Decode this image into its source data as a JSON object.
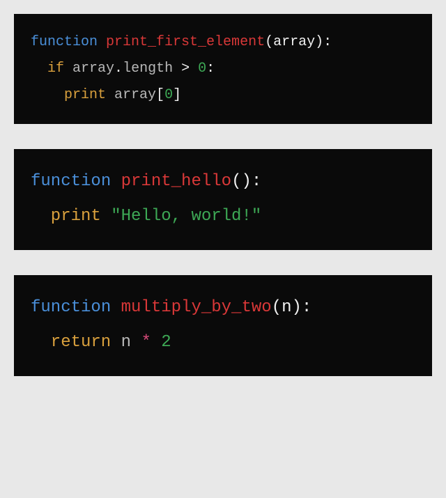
{
  "blocks": [
    {
      "lines": [
        {
          "indent": 0,
          "tokens": [
            {
              "cls": "kw",
              "t": "function"
            },
            {
              "cls": "",
              "t": " "
            },
            {
              "cls": "fn",
              "t": "print_first_element"
            },
            {
              "cls": "paren",
              "t": "("
            },
            {
              "cls": "param",
              "t": "array"
            },
            {
              "cls": "paren",
              "t": ")"
            },
            {
              "cls": "colon",
              "t": ":"
            }
          ]
        },
        {
          "indent": 1,
          "tokens": [
            {
              "cls": "ctrl",
              "t": "if"
            },
            {
              "cls": "",
              "t": " "
            },
            {
              "cls": "ident",
              "t": "array"
            },
            {
              "cls": "dot",
              "t": "."
            },
            {
              "cls": "ident",
              "t": "length"
            },
            {
              "cls": "",
              "t": " "
            },
            {
              "cls": "op",
              "t": ">"
            },
            {
              "cls": "",
              "t": " "
            },
            {
              "cls": "num",
              "t": "0"
            },
            {
              "cls": "colon",
              "t": ":"
            }
          ]
        },
        {
          "indent": 2,
          "tokens": [
            {
              "cls": "ctrl",
              "t": "print"
            },
            {
              "cls": "",
              "t": " "
            },
            {
              "cls": "ident",
              "t": "array"
            },
            {
              "cls": "paren",
              "t": "["
            },
            {
              "cls": "num",
              "t": "0"
            },
            {
              "cls": "paren",
              "t": "]"
            }
          ]
        }
      ]
    },
    {
      "lines": [
        {
          "indent": 0,
          "tokens": [
            {
              "cls": "kw",
              "t": "function"
            },
            {
              "cls": "",
              "t": " "
            },
            {
              "cls": "fn",
              "t": "print_hello"
            },
            {
              "cls": "paren",
              "t": "("
            },
            {
              "cls": "paren",
              "t": ")"
            },
            {
              "cls": "colon",
              "t": ":"
            }
          ]
        },
        {
          "indent": 1,
          "tokens": [
            {
              "cls": "ctrl",
              "t": "print"
            },
            {
              "cls": "",
              "t": " "
            },
            {
              "cls": "str",
              "t": "\"Hello, world!\""
            }
          ]
        }
      ]
    },
    {
      "lines": [
        {
          "indent": 0,
          "tokens": [
            {
              "cls": "kw",
              "t": "function"
            },
            {
              "cls": "",
              "t": " "
            },
            {
              "cls": "fn",
              "t": "multiply_by_two"
            },
            {
              "cls": "paren",
              "t": "("
            },
            {
              "cls": "param",
              "t": "n"
            },
            {
              "cls": "paren",
              "t": ")"
            },
            {
              "cls": "colon",
              "t": ":"
            }
          ]
        },
        {
          "indent": 1,
          "tokens": [
            {
              "cls": "ctrl",
              "t": "return"
            },
            {
              "cls": "",
              "t": " "
            },
            {
              "cls": "ident",
              "t": "n"
            },
            {
              "cls": "",
              "t": " "
            },
            {
              "cls": "pink",
              "t": "*"
            },
            {
              "cls": "",
              "t": " "
            },
            {
              "cls": "num",
              "t": "2"
            }
          ]
        }
      ]
    }
  ]
}
